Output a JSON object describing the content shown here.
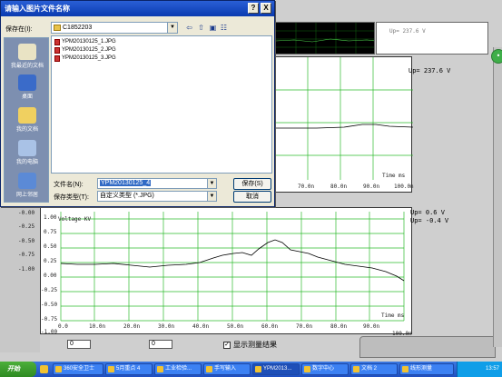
{
  "dialog": {
    "title": "请输入图片文件名称",
    "help": "?",
    "close": "X",
    "look_in_label": "保存在(I):",
    "look_in_value": "C1852203",
    "files": [
      "YPM20130125_1.JPG",
      "YPM20130125_2.JPG",
      "YPM20130125_3.JPG"
    ],
    "places": [
      "我最近的文档",
      "桌面",
      "我的文档",
      "我的电脑",
      "网上邻居"
    ],
    "filename_label": "文件名(N):",
    "filename_value": "YPM20130125_4",
    "filetype_label": "保存类型(T):",
    "filetype_value": "自定义类型 (*.JPG)",
    "save_button": "保存(S)",
    "cancel_button": "取消"
  },
  "scope": {
    "top_readout": "Up= 237.6 V",
    "upper_readout": "Up= 237.6 V",
    "lower_readout_1": "Up= 0.6 V",
    "lower_readout_2": "Up= -0.4 V",
    "lower_title": "Voltage KV",
    "time_unit": "Time ms",
    "upper_x_ticks": [
      "70.0n",
      "80.0n",
      "90.0n",
      "100.0n"
    ],
    "lower_x_ticks": [
      "0.0",
      "10.0n",
      "20.0n",
      "30.0n",
      "40.0n",
      "50.0n",
      "60.0n",
      "70.0n",
      "80.0n",
      "90.0n",
      "100.0n"
    ],
    "lower_y_ticks": [
      "1.00",
      "0.75",
      "0.50",
      "0.25",
      "0.00",
      "-0.25",
      "-0.50",
      "-0.75",
      "-1.00"
    ],
    "left_y_ticks": [
      "-0.00",
      "-0.25",
      "-0.50",
      "-0.75",
      "-1.00"
    ],
    "spin_1": "0",
    "spin_2": "0",
    "show_check_label": "显示测量结果",
    "show_check_mark": "✓"
  },
  "taskbar": {
    "start": "开始",
    "tasks": [
      "360安全卫士",
      "5月重点 4",
      "工业检验...",
      "手写输入",
      "YPM2013...",
      "数字中心",
      "文档 2",
      "线形测量"
    ],
    "clock": "13:57"
  },
  "colors": {
    "grid": "#2dbb2d",
    "title_bar": "#0a3bb0",
    "taskbar": "#245edb"
  }
}
